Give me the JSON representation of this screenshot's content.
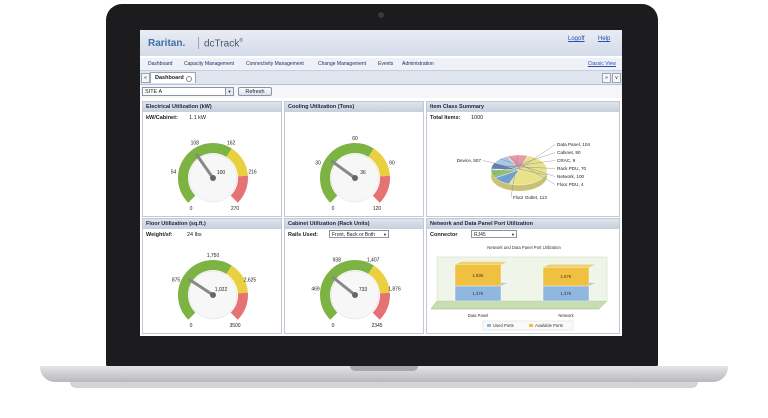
{
  "header": {
    "logo": "Raritan.",
    "product": "dcTrack",
    "product_mark": "®",
    "logoff": "Logoff",
    "help": "Help"
  },
  "nav": {
    "items": [
      "Dashboard",
      "Capacity Management",
      "Connectivity Management",
      "Change Management",
      "Events",
      "Administration"
    ],
    "classic_view": "Classic View"
  },
  "tabs": {
    "active": "Dashboard",
    "left_arrow": "«",
    "right_arrow": "»",
    "menu_arrow": "v"
  },
  "toolbar": {
    "site": "SITE A",
    "refresh": "Refresh"
  },
  "panels": {
    "electrical": {
      "title": "Electrical Utilization (kW)",
      "stat_label": "kW/Cabinet:",
      "stat_value": "1.1 kW",
      "gauge": {
        "min": "0",
        "max": "270",
        "value": 100,
        "value_label": "100",
        "ticks": [
          "54",
          "108",
          "162",
          "216"
        ],
        "needle_fraction": 0.37
      }
    },
    "cooling": {
      "title": "Cooling Utilization (Tons)",
      "gauge": {
        "min": "0",
        "max": "120",
        "value": 36,
        "value_label": "36",
        "ticks": [
          "30",
          "60",
          "90"
        ],
        "needle_fraction": 0.3
      }
    },
    "item_class": {
      "title": "Item Class Summary",
      "stat_label": "Total Items:",
      "stat_value": "1000",
      "slices": [
        {
          "label": "Device, 507",
          "value": 507,
          "color": "#e8e28a"
        },
        {
          "label": "Data Panel, 104",
          "value": 104,
          "color": "#6fa0d8"
        },
        {
          "label": "Cabinet, 90",
          "value": 90,
          "color": "#8fbf70"
        },
        {
          "label": "CRAC, 9",
          "value": 9,
          "color": "#c0c0c0"
        },
        {
          "label": "Rack PDU, 70",
          "value": 70,
          "color": "#5a7fb8"
        },
        {
          "label": "Network, 100",
          "value": 100,
          "color": "#a6c9e8"
        },
        {
          "label": "Floor PDU, 4",
          "value": 4,
          "color": "#d9a0c0"
        },
        {
          "label": "Floor Outlet, 113",
          "value": 113,
          "color": "#e89aa8"
        }
      ]
    },
    "floor": {
      "title": "Floor Utilization (sq.ft.)",
      "stat_label": "Weight/sf:",
      "stat_value": "24 lbs",
      "gauge": {
        "min": "0",
        "max": "3500",
        "value": 1022,
        "value_label": "1,022",
        "ticks": [
          "875",
          "1,750",
          "2,625"
        ],
        "needle_fraction": 0.29
      }
    },
    "cabinet": {
      "title": "Cabinet Utilization (Rack Units)",
      "stat_label": "Rails Used:",
      "rails_select": "Front, Back or Both",
      "gauge": {
        "min": "0",
        "max": "2345",
        "value": 733,
        "value_label": "733",
        "ticks": [
          "469",
          "938",
          "1,407",
          "1,876"
        ],
        "needle_fraction": 0.31
      }
    },
    "network": {
      "title": "Network and Data Panel Port Utilization",
      "stat_label": "Connector",
      "connector_select": "RJ45",
      "chart_title": "Network and Data Panel Port Utilization"
    }
  },
  "chart_data": {
    "type": "bar",
    "title": "Network and Data Panel Port Utilization",
    "categories": [
      "Data Panel",
      "Network"
    ],
    "series": [
      {
        "name": "Used Ports",
        "values": [
          1.37,
          1.37
        ],
        "labels": [
          "1.37K",
          "1.37K"
        ],
        "color": "#8fb7e0"
      },
      {
        "name": "Available Ports",
        "values": [
          1.93,
          1.67
        ],
        "labels": [
          "1.93K",
          "1.67K"
        ],
        "color": "#f0c040"
      }
    ],
    "stacked": true,
    "legend": "bottom"
  },
  "colors": {
    "gauge_green": "#7cb342",
    "gauge_yellow": "#e8d040",
    "gauge_red": "#e57373",
    "accent": "#3f6ea8"
  }
}
